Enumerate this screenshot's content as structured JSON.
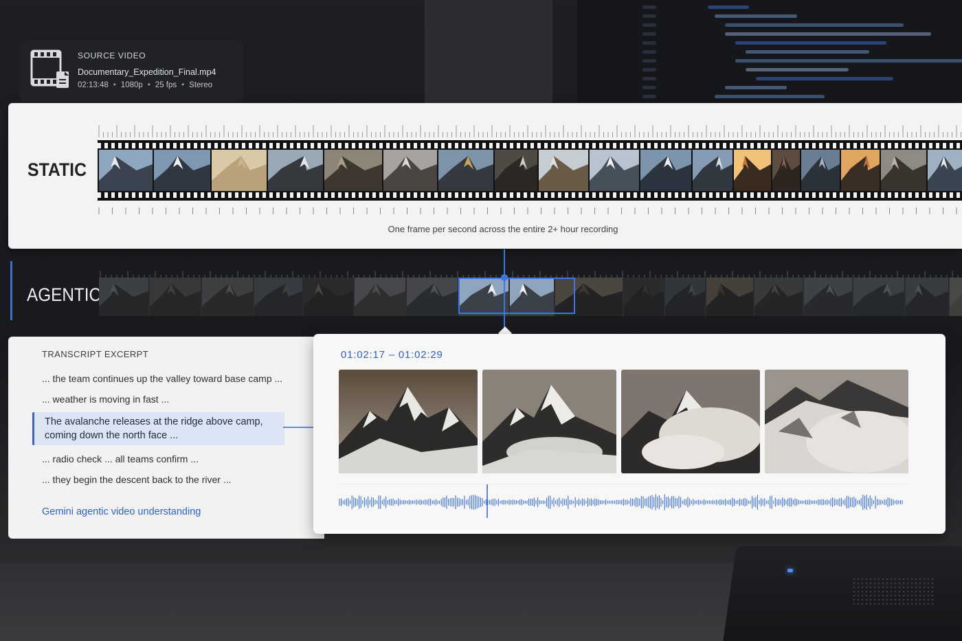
{
  "source": {
    "label": "SOURCE VIDEO",
    "filename": "Documentary_Expedition_Final.mp4",
    "duration": "02:13:48",
    "resolution": "1080p",
    "fps": "25 fps",
    "audio": "Stereo"
  },
  "static": {
    "title": "STATIC",
    "caption": "One frame per second across the entire 2+ hour recording"
  },
  "agentic": {
    "title": "AGENTIC"
  },
  "transcript": {
    "heading": "TRANSCRIPT EXCERPT",
    "lines": [
      "... the team continues up the valley toward base camp ...",
      "... weather is moving in fast ...",
      "... radio check ... all teams confirm ...",
      "... they begin the descent back to the river ..."
    ],
    "highlight_line1": "The avalanche releases at the ridge above camp,",
    "highlight_line2": "coming down the north face ...",
    "link": "Gemini agentic video understanding"
  },
  "clip": {
    "time_range": "01:02:17 – 01:02:29"
  },
  "colors": {
    "accent": "#3d76e8",
    "link": "#2f62c9",
    "highlight_bg": "#dce5f5"
  }
}
